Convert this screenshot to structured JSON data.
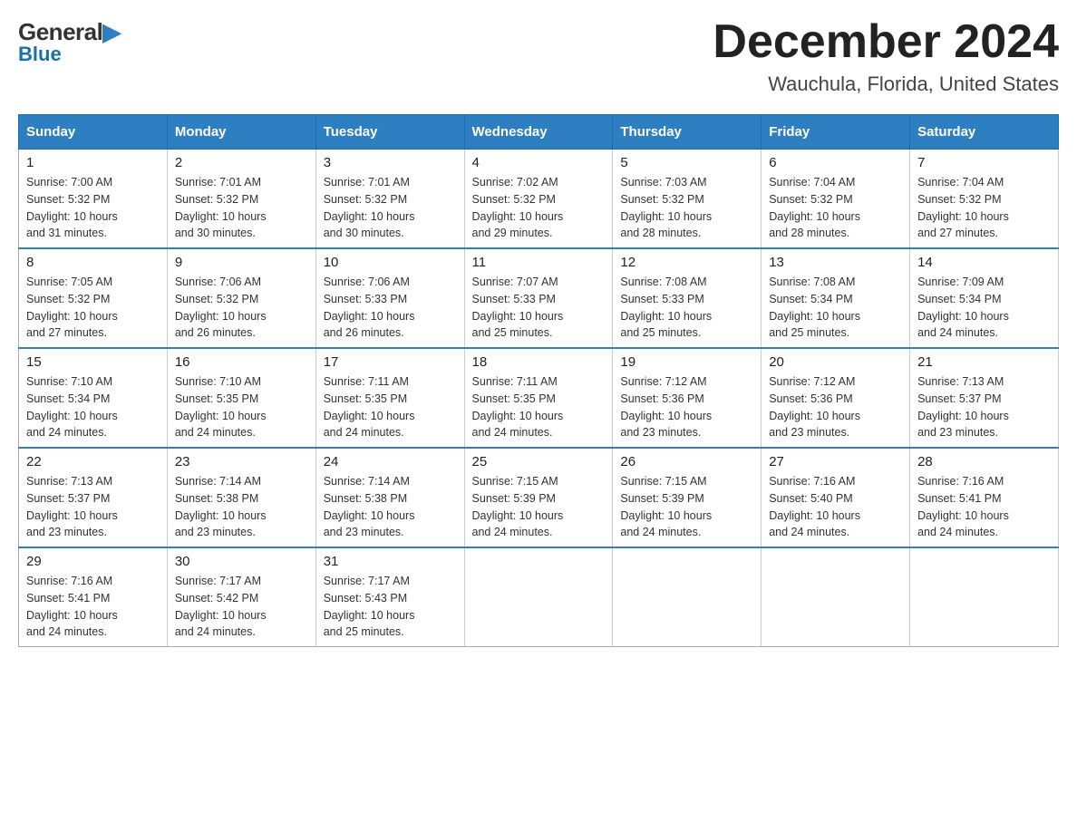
{
  "header": {
    "logo_general": "General",
    "logo_blue": "Blue",
    "month_title": "December 2024",
    "location": "Wauchula, Florida, United States"
  },
  "days_of_week": [
    "Sunday",
    "Monday",
    "Tuesday",
    "Wednesday",
    "Thursday",
    "Friday",
    "Saturday"
  ],
  "weeks": [
    [
      {
        "day": "1",
        "sunrise": "7:00 AM",
        "sunset": "5:32 PM",
        "daylight": "10 hours and 31 minutes."
      },
      {
        "day": "2",
        "sunrise": "7:01 AM",
        "sunset": "5:32 PM",
        "daylight": "10 hours and 30 minutes."
      },
      {
        "day": "3",
        "sunrise": "7:01 AM",
        "sunset": "5:32 PM",
        "daylight": "10 hours and 30 minutes."
      },
      {
        "day": "4",
        "sunrise": "7:02 AM",
        "sunset": "5:32 PM",
        "daylight": "10 hours and 29 minutes."
      },
      {
        "day": "5",
        "sunrise": "7:03 AM",
        "sunset": "5:32 PM",
        "daylight": "10 hours and 28 minutes."
      },
      {
        "day": "6",
        "sunrise": "7:04 AM",
        "sunset": "5:32 PM",
        "daylight": "10 hours and 28 minutes."
      },
      {
        "day": "7",
        "sunrise": "7:04 AM",
        "sunset": "5:32 PM",
        "daylight": "10 hours and 27 minutes."
      }
    ],
    [
      {
        "day": "8",
        "sunrise": "7:05 AM",
        "sunset": "5:32 PM",
        "daylight": "10 hours and 27 minutes."
      },
      {
        "day": "9",
        "sunrise": "7:06 AM",
        "sunset": "5:32 PM",
        "daylight": "10 hours and 26 minutes."
      },
      {
        "day": "10",
        "sunrise": "7:06 AM",
        "sunset": "5:33 PM",
        "daylight": "10 hours and 26 minutes."
      },
      {
        "day": "11",
        "sunrise": "7:07 AM",
        "sunset": "5:33 PM",
        "daylight": "10 hours and 25 minutes."
      },
      {
        "day": "12",
        "sunrise": "7:08 AM",
        "sunset": "5:33 PM",
        "daylight": "10 hours and 25 minutes."
      },
      {
        "day": "13",
        "sunrise": "7:08 AM",
        "sunset": "5:34 PM",
        "daylight": "10 hours and 25 minutes."
      },
      {
        "day": "14",
        "sunrise": "7:09 AM",
        "sunset": "5:34 PM",
        "daylight": "10 hours and 24 minutes."
      }
    ],
    [
      {
        "day": "15",
        "sunrise": "7:10 AM",
        "sunset": "5:34 PM",
        "daylight": "10 hours and 24 minutes."
      },
      {
        "day": "16",
        "sunrise": "7:10 AM",
        "sunset": "5:35 PM",
        "daylight": "10 hours and 24 minutes."
      },
      {
        "day": "17",
        "sunrise": "7:11 AM",
        "sunset": "5:35 PM",
        "daylight": "10 hours and 24 minutes."
      },
      {
        "day": "18",
        "sunrise": "7:11 AM",
        "sunset": "5:35 PM",
        "daylight": "10 hours and 24 minutes."
      },
      {
        "day": "19",
        "sunrise": "7:12 AM",
        "sunset": "5:36 PM",
        "daylight": "10 hours and 23 minutes."
      },
      {
        "day": "20",
        "sunrise": "7:12 AM",
        "sunset": "5:36 PM",
        "daylight": "10 hours and 23 minutes."
      },
      {
        "day": "21",
        "sunrise": "7:13 AM",
        "sunset": "5:37 PM",
        "daylight": "10 hours and 23 minutes."
      }
    ],
    [
      {
        "day": "22",
        "sunrise": "7:13 AM",
        "sunset": "5:37 PM",
        "daylight": "10 hours and 23 minutes."
      },
      {
        "day": "23",
        "sunrise": "7:14 AM",
        "sunset": "5:38 PM",
        "daylight": "10 hours and 23 minutes."
      },
      {
        "day": "24",
        "sunrise": "7:14 AM",
        "sunset": "5:38 PM",
        "daylight": "10 hours and 23 minutes."
      },
      {
        "day": "25",
        "sunrise": "7:15 AM",
        "sunset": "5:39 PM",
        "daylight": "10 hours and 24 minutes."
      },
      {
        "day": "26",
        "sunrise": "7:15 AM",
        "sunset": "5:39 PM",
        "daylight": "10 hours and 24 minutes."
      },
      {
        "day": "27",
        "sunrise": "7:16 AM",
        "sunset": "5:40 PM",
        "daylight": "10 hours and 24 minutes."
      },
      {
        "day": "28",
        "sunrise": "7:16 AM",
        "sunset": "5:41 PM",
        "daylight": "10 hours and 24 minutes."
      }
    ],
    [
      {
        "day": "29",
        "sunrise": "7:16 AM",
        "sunset": "5:41 PM",
        "daylight": "10 hours and 24 minutes."
      },
      {
        "day": "30",
        "sunrise": "7:17 AM",
        "sunset": "5:42 PM",
        "daylight": "10 hours and 24 minutes."
      },
      {
        "day": "31",
        "sunrise": "7:17 AM",
        "sunset": "5:43 PM",
        "daylight": "10 hours and 25 minutes."
      },
      null,
      null,
      null,
      null
    ]
  ],
  "labels": {
    "sunrise": "Sunrise:",
    "sunset": "Sunset:",
    "daylight": "Daylight:"
  }
}
